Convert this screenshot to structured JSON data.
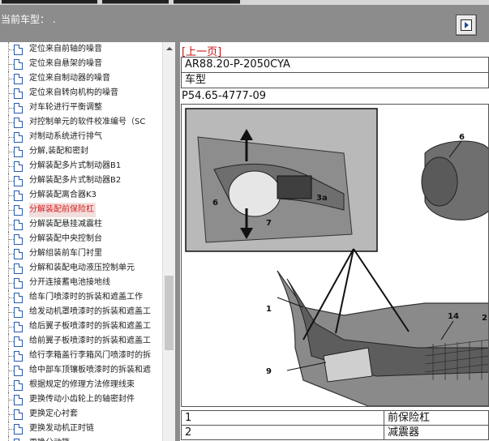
{
  "header": {
    "model_label": "当前车型： ."
  },
  "tree": {
    "items": [
      {
        "label": "定位来自前轴的噪音",
        "selected": false
      },
      {
        "label": "定位来自悬架的噪音",
        "selected": false
      },
      {
        "label": "定位来自制动器的噪音",
        "selected": false
      },
      {
        "label": "定位来自转向机构的噪音",
        "selected": false
      },
      {
        "label": "对车轮进行平衡调整",
        "selected": false
      },
      {
        "label": "对控制单元的软件校准编号（SC",
        "selected": false
      },
      {
        "label": "对制动系统进行排气",
        "selected": false
      },
      {
        "label": "分解,装配和密封",
        "selected": false
      },
      {
        "label": "分解装配多片式制动器B1",
        "selected": false
      },
      {
        "label": "分解装配多片式制动器B2",
        "selected": false
      },
      {
        "label": "分解装配离合器K3",
        "selected": false
      },
      {
        "label": "分解装配前保险杠",
        "selected": true
      },
      {
        "label": "分解装配悬挂减震柱",
        "selected": false
      },
      {
        "label": "分解装配中央控制台",
        "selected": false
      },
      {
        "label": "分解组装前车门衬里",
        "selected": false
      },
      {
        "label": "分解和装配电动液压控制单元",
        "selected": false
      },
      {
        "label": "分开连接蓄电池接地线",
        "selected": false
      },
      {
        "label": "给车门喷漆时的拆装和遮盖工作",
        "selected": false
      },
      {
        "label": "给发动机罩喷漆时的拆装和遮盖工",
        "selected": false
      },
      {
        "label": "给后翼子板喷漆时的拆装和遮盖工",
        "selected": false
      },
      {
        "label": "给前翼子板喷漆时的拆装和遮盖工",
        "selected": false
      },
      {
        "label": "给行李箱盖行李箱风门喷漆时的拆",
        "selected": false
      },
      {
        "label": "给中部车顶镶板喷漆时的拆装和遮",
        "selected": false
      },
      {
        "label": "根据规定的修理方法修理线束",
        "selected": false
      },
      {
        "label": "更换传动小齿轮上的轴密封件",
        "selected": false
      },
      {
        "label": "更换定心衬套",
        "selected": false
      },
      {
        "label": "更换发动机正时链",
        "selected": false
      },
      {
        "label": "更换分动箱",
        "selected": false
      }
    ]
  },
  "content": {
    "prev_link": "[上一页]",
    "doc_code": "AR88.20-P-2050CYA",
    "vehicle_label": "车型",
    "figure_code": "P54.65-4777-09",
    "figure_callouts": [
      "6",
      "7",
      "3a",
      "6",
      "1",
      "14",
      "2",
      "9"
    ],
    "legend": [
      {
        "num": "1",
        "desc": "前保险杠"
      },
      {
        "num": "2",
        "desc": "减震器"
      }
    ]
  },
  "colors": {
    "header_bg": "#8c8c8c",
    "link_red": "#c81010",
    "selected_red": "#d42020"
  }
}
